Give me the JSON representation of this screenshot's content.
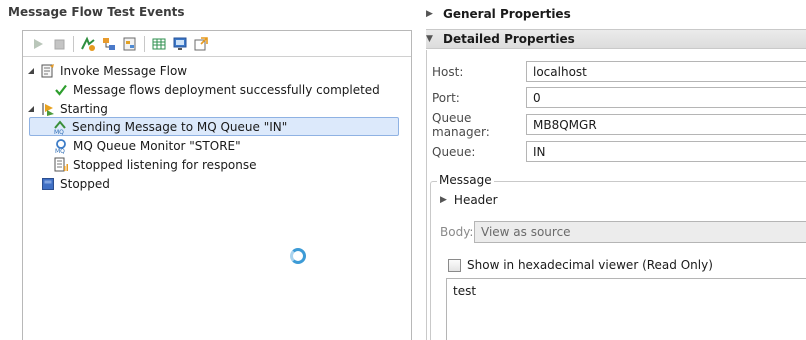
{
  "left_panel": {
    "title": "Message Flow Test Events",
    "toolbar": [
      {
        "icon": "run-icon"
      },
      {
        "icon": "stop-icon"
      },
      {
        "separator": true
      },
      {
        "icon": "new-event-icon"
      },
      {
        "icon": "flow-icon"
      },
      {
        "icon": "deploy-icon"
      },
      {
        "separator": true
      },
      {
        "icon": "table-icon"
      },
      {
        "icon": "monitor-icon"
      },
      {
        "icon": "export-icon"
      }
    ],
    "tree": [
      {
        "label": "Invoke Message Flow",
        "icon": "invoke-flow-icon",
        "twisty": "expanded",
        "depth": 0
      },
      {
        "label": "Message flows deployment successfully completed",
        "icon": "checkmark-icon",
        "twisty": "none",
        "depth": 1
      },
      {
        "label": "Starting",
        "icon": "starting-icon",
        "twisty": "expanded",
        "depth": 0
      },
      {
        "label": "Sending Message to MQ Queue \"IN\"",
        "icon": "mq-send-icon",
        "twisty": "none",
        "depth": 1,
        "selected": true
      },
      {
        "label": "MQ Queue Monitor \"STORE\"",
        "icon": "mq-monitor-icon",
        "twisty": "none",
        "depth": 1
      },
      {
        "label": "Stopped listening for response",
        "icon": "stopped-listening-icon",
        "twisty": "none",
        "depth": 1
      },
      {
        "label": "Stopped",
        "icon": "stopped-icon",
        "twisty": "none",
        "depth": 0
      }
    ]
  },
  "right_panel": {
    "general_properties": "General Properties",
    "detailed_properties": "Detailed Properties",
    "fields": [
      {
        "label": "Host:",
        "value": "localhost"
      },
      {
        "label": "Port:",
        "value": "0"
      },
      {
        "label": "Queue manager:",
        "value": "MB8QMGR"
      },
      {
        "label": "Queue:",
        "value": "IN"
      }
    ],
    "message_group": {
      "title": "Message",
      "header": "Header",
      "body_label": "Body:",
      "body_value": "View as source",
      "hex_checkbox": "Show in hexadecimal viewer (Read Only)",
      "hex_checked": false,
      "content": "test"
    }
  },
  "colors": {
    "selection_bg": "#dce9fb",
    "selection_border": "#8fb2e3",
    "spinner": "#3d9bd6",
    "check_green": "#2e9e2e",
    "stopped_blue": "#3f6fc4"
  }
}
